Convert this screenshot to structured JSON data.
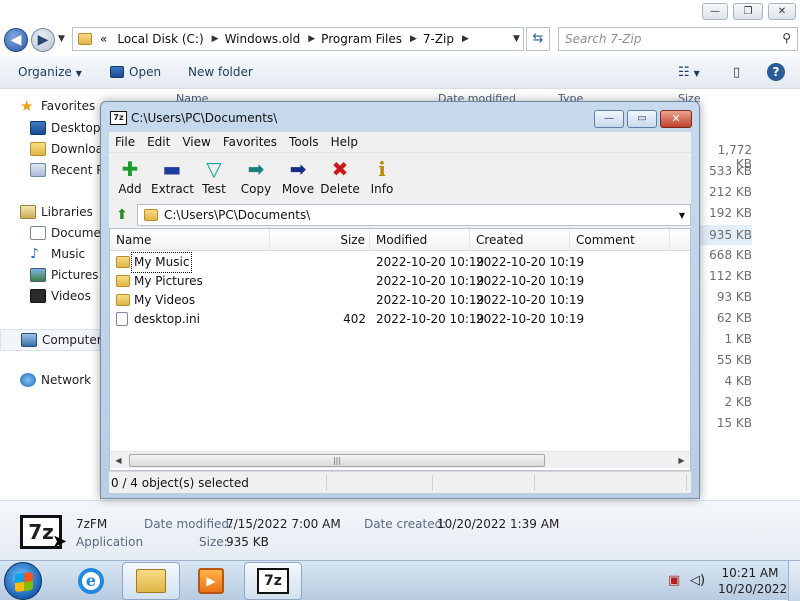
{
  "explorer": {
    "window_controls": [
      "—",
      "❐",
      "✕"
    ],
    "breadcrumb": {
      "overflow": "«",
      "items": [
        "Local Disk (C:)",
        "Windows.old",
        "Program Files",
        "7-Zip"
      ]
    },
    "search_placeholder": "Search 7-Zip",
    "command_bar": {
      "organize": "Organize",
      "open": "Open",
      "new_folder": "New folder"
    },
    "columns": [
      "Name",
      "Date modified",
      "Type",
      "Size"
    ],
    "nav_pane": {
      "favorites": "Favorites",
      "favorites_items": [
        "Desktop",
        "Downloads",
        "Recent Places"
      ],
      "libraries": "Libraries",
      "libraries_items": [
        "Documents",
        "Music",
        "Pictures",
        "Videos"
      ],
      "computer": "Computer",
      "network": "Network"
    },
    "sizes": [
      "1,772 KB",
      "533 KB",
      "212 KB",
      "192 KB",
      "935 KB",
      "668 KB",
      "112 KB",
      "93 KB",
      "62 KB",
      "1 KB",
      "55 KB",
      "4 KB",
      "2 KB",
      "15 KB"
    ],
    "selected_size_index": 4,
    "details": {
      "name": "7zFM",
      "type": "Application",
      "date_modified_label": "Date modified:",
      "date_modified": "7/15/2022 7:00 AM",
      "date_created_label": "Date created:",
      "date_created": "10/20/2022 1:39 AM",
      "size_label": "Size:",
      "size": "935 KB",
      "logo_text": "7z"
    }
  },
  "zip_window": {
    "title": "C:\\Users\\PC\\Documents\\",
    "icon_text": "7z",
    "menu": [
      "File",
      "Edit",
      "View",
      "Favorites",
      "Tools",
      "Help"
    ],
    "toolbar": [
      {
        "label": "Add",
        "icon": "add-icon",
        "glyph": "✚"
      },
      {
        "label": "Extract",
        "icon": "extract-icon",
        "glyph": "▬"
      },
      {
        "label": "Test",
        "icon": "test-icon",
        "glyph": "▽"
      },
      {
        "label": "Copy",
        "icon": "copy-icon",
        "glyph": "➡"
      },
      {
        "label": "Move",
        "icon": "move-icon",
        "glyph": "➡"
      },
      {
        "label": "Delete",
        "icon": "delete-icon",
        "glyph": "✖"
      },
      {
        "label": "Info",
        "icon": "info-icon",
        "glyph": "i"
      }
    ],
    "path": "C:\\Users\\PC\\Documents\\",
    "columns": [
      "Name",
      "Size",
      "Modified",
      "Created",
      "Comment"
    ],
    "files": [
      {
        "name": "My Music",
        "size": "",
        "modified": "2022-10-20 10:19",
        "created": "2022-10-20 10:19",
        "type": "folder"
      },
      {
        "name": "My Pictures",
        "size": "",
        "modified": "2022-10-20 10:19",
        "created": "2022-10-20 10:19",
        "type": "folder"
      },
      {
        "name": "My Videos",
        "size": "",
        "modified": "2022-10-20 10:19",
        "created": "2022-10-20 10:19",
        "type": "folder"
      },
      {
        "name": "desktop.ini",
        "size": "402",
        "modified": "2022-10-20 10:19",
        "created": "2022-10-20 10:19",
        "type": "file"
      }
    ],
    "status": "0 / 4 object(s) selected"
  },
  "taskbar": {
    "time": "10:21 AM",
    "date": "10/20/2022",
    "pinned": [
      "internet-explorer-icon",
      "windows-explorer-icon",
      "media-player-icon",
      "7zip-icon"
    ],
    "zip_text": "7z"
  },
  "colors": {
    "accent": "#1e395b",
    "selection": "#e4eef9",
    "window_frame": "#c7d9ed"
  }
}
